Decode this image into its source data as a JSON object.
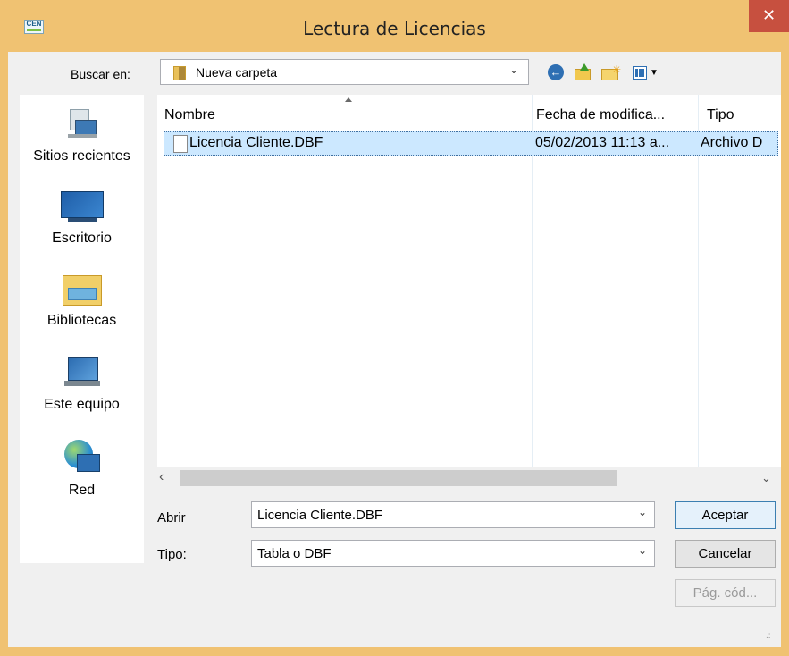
{
  "window": {
    "title": "Lectura de Licencias",
    "close_glyph": "✕",
    "app_icon_text": "CEN"
  },
  "toolbar": {
    "lookin_label": "Buscar en:",
    "lookin_value": "Nueva carpeta",
    "icons": [
      "back-icon",
      "up-folder-icon",
      "new-folder-icon",
      "view-menu-icon"
    ]
  },
  "places": [
    {
      "label": "Sitios recientes",
      "icon": "recent-places-icon"
    },
    {
      "label": "Escritorio",
      "icon": "desktop-icon"
    },
    {
      "label": "Bibliotecas",
      "icon": "libraries-icon"
    },
    {
      "label": "Este equipo",
      "icon": "this-pc-icon"
    },
    {
      "label": "Red",
      "icon": "network-icon"
    }
  ],
  "filelist": {
    "columns": [
      "Nombre",
      "Fecha de modifica...",
      "Tipo"
    ],
    "rows": [
      {
        "name": "Licencia Cliente.DBF",
        "modified": "05/02/2013 11:13 a...",
        "type": "Archivo D"
      }
    ],
    "selected_row": 0
  },
  "form": {
    "open_label": "Abrir",
    "open_value": "Licencia Cliente.DBF",
    "type_label": "Tipo:",
    "type_value": "Tabla o DBF"
  },
  "buttons": {
    "accept": "Aceptar",
    "cancel": "Cancelar",
    "codepage": "Pág. cód..."
  },
  "glyphs": {
    "chevron_down": "⌄",
    "left_arrow": "‹",
    "down_arrow": "⌄",
    "resize_grip": ".:"
  },
  "colors": {
    "title_bar": "#f0c272",
    "close_button": "#c7503f",
    "selection": "#cce8ff",
    "dialog_bg": "#f0f0f0"
  }
}
